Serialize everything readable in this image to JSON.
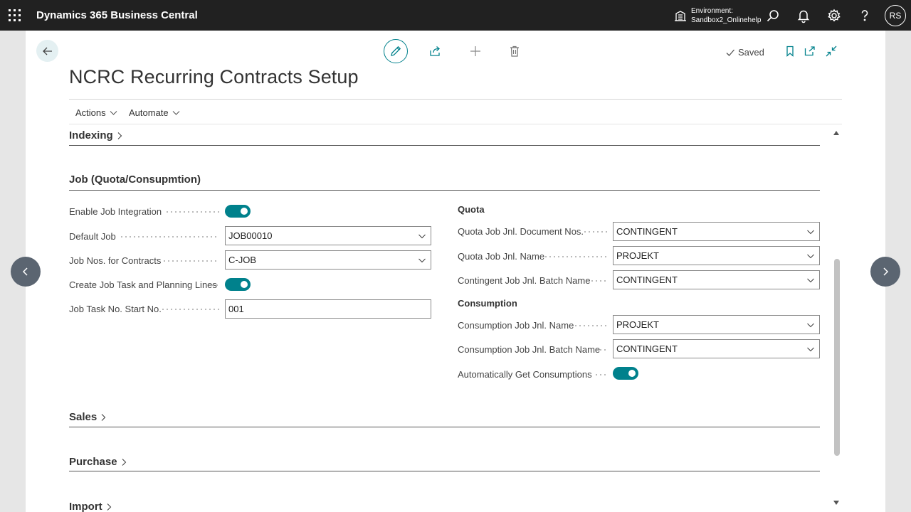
{
  "topbar": {
    "app_title": "Dynamics 365 Business Central",
    "environment_label": "Environment:",
    "environment_value": "Sandbox2_Onlinehelp",
    "avatar_initials": "RS",
    "icons": [
      "apps-waffle-icon",
      "building-icon",
      "search-icon",
      "bell-icon",
      "gear-icon",
      "help-icon"
    ]
  },
  "toolbar": {
    "saved_label": "Saved",
    "icons": [
      "back-arrow-icon",
      "edit-pencil-icon",
      "share-icon",
      "add-plus-icon",
      "delete-trash-icon",
      "bookmark-icon",
      "open-new-window-icon",
      "collapse-icon"
    ]
  },
  "page": {
    "title": "NCRC Recurring Contracts Setup"
  },
  "menu": {
    "actions": "Actions",
    "automate": "Automate"
  },
  "sections": {
    "indexing": "Indexing",
    "job": "Job (Quota/Consupmtion)",
    "sales": "Sales",
    "purchase": "Purchase",
    "import": "Import"
  },
  "job": {
    "enable_job_integration": {
      "label": "Enable Job Integration",
      "value": true
    },
    "default_job": {
      "label": "Default Job",
      "value": "JOB00010"
    },
    "job_nos_for_contracts": {
      "label": "Job Nos. for Contracts",
      "value": "C-JOB"
    },
    "create_job_task": {
      "label": "Create Job Task and Planning Lines",
      "value": true
    },
    "job_task_start_no": {
      "label": "Job Task No. Start No.",
      "value": "001"
    },
    "quota": {
      "heading": "Quota",
      "doc_nos": {
        "label": "Quota Job Jnl. Document Nos.",
        "value": "CONTINGENT"
      },
      "jnl_name": {
        "label": "Quota Job Jnl. Name",
        "value": "PROJEKT"
      },
      "batch_name": {
        "label": "Contingent Job Jnl. Batch Name",
        "value": "CONTINGENT"
      }
    },
    "consumption": {
      "heading": "Consumption",
      "jnl_name": {
        "label": "Consumption Job Jnl. Name",
        "value": "PROJEKT"
      },
      "batch_name": {
        "label": "Consumption Job Jnl. Batch Name",
        "value": "CONTINGENT"
      },
      "auto_get": {
        "label": "Automatically Get Consumptions",
        "value": true
      }
    }
  },
  "colors": {
    "accent": "#00818c",
    "topbar": "#212121",
    "nav_arrow": "#5b6571"
  }
}
